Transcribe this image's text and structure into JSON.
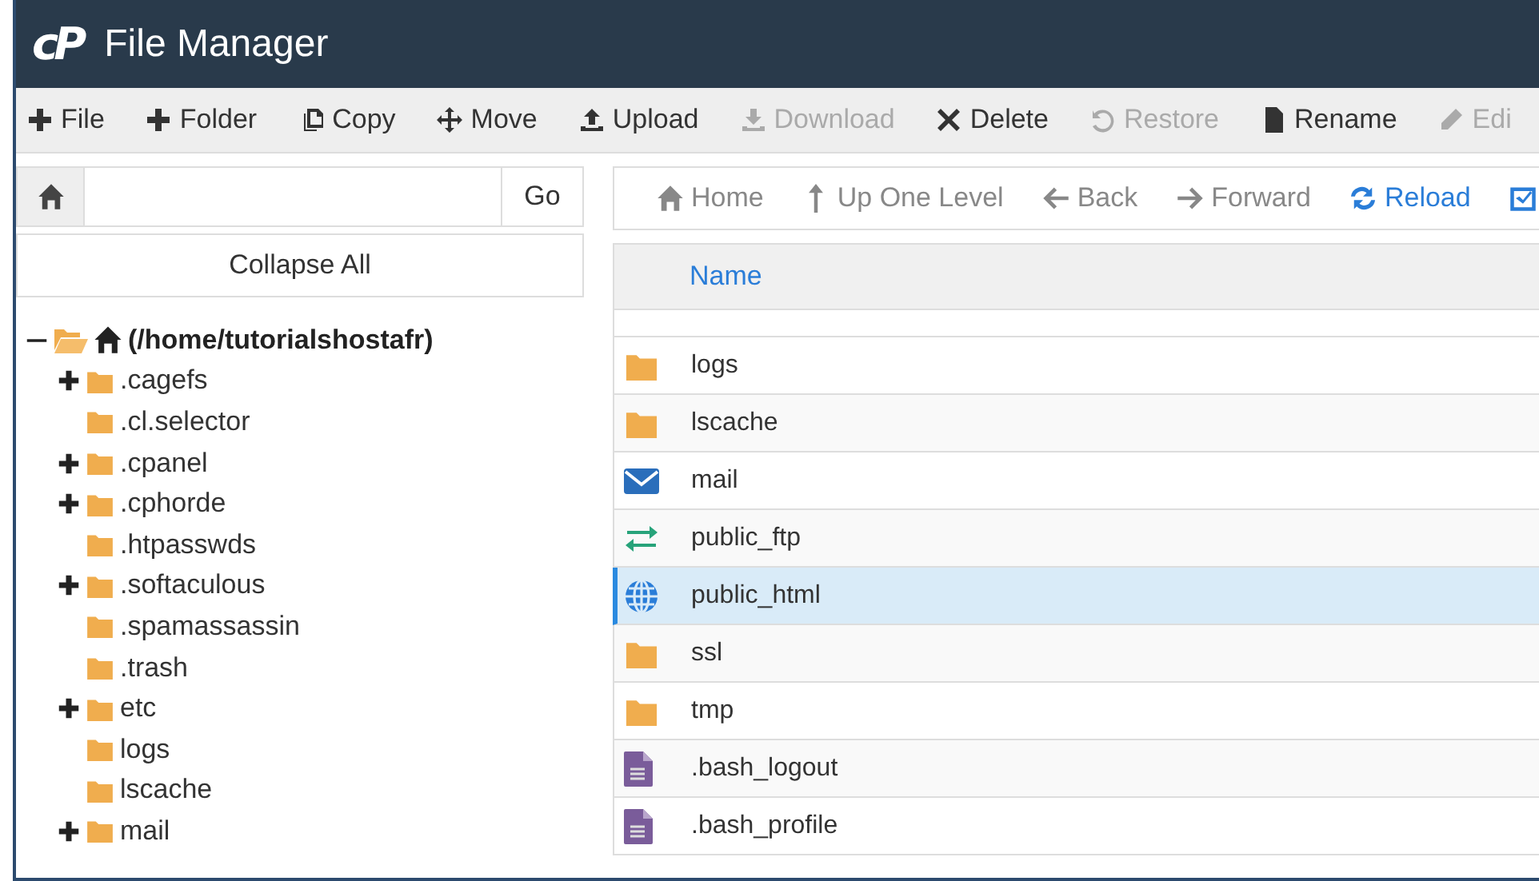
{
  "window": {
    "logo": "cP",
    "title": "File Manager"
  },
  "toolbar": [
    {
      "kind": "plus",
      "label": "File",
      "disabled": false
    },
    {
      "kind": "plus",
      "label": "Folder",
      "disabled": false
    },
    {
      "kind": "copy",
      "label": "Copy",
      "disabled": false
    },
    {
      "kind": "move",
      "label": "Move",
      "disabled": false
    },
    {
      "kind": "upload",
      "label": "Upload",
      "disabled": false
    },
    {
      "kind": "download",
      "label": "Download",
      "disabled": true
    },
    {
      "kind": "x",
      "label": "Delete",
      "disabled": false
    },
    {
      "kind": "restore",
      "label": "Restore",
      "disabled": true
    },
    {
      "kind": "file",
      "label": "Rename",
      "disabled": false
    },
    {
      "kind": "pencil",
      "label": "Edi",
      "disabled": true
    }
  ],
  "path_bar": {
    "button": "Go"
  },
  "collapse_button": "Collapse All",
  "tree": [
    {
      "label": "(/home/tutorialshostafr)",
      "kind": "home",
      "expanded": true,
      "children": [
        {
          "label": ".cagefs",
          "expandable": true
        },
        {
          "label": ".cl.selector",
          "expandable": false
        },
        {
          "label": ".cpanel",
          "expandable": true
        },
        {
          "label": ".cphorde",
          "expandable": true
        },
        {
          "label": ".htpasswds",
          "expandable": false
        },
        {
          "label": ".softaculous",
          "expandable": true
        },
        {
          "label": ".spamassassin",
          "expandable": false
        },
        {
          "label": ".trash",
          "expandable": false
        },
        {
          "label": "etc",
          "expandable": true
        },
        {
          "label": "logs",
          "expandable": false
        },
        {
          "label": "lscache",
          "expandable": false
        },
        {
          "label": "mail",
          "expandable": true
        }
      ]
    }
  ],
  "nav": [
    {
      "kind": "home",
      "label": "Home",
      "disabled": true
    },
    {
      "kind": "up",
      "label": "Up One Level",
      "disabled": true
    },
    {
      "kind": "back",
      "label": "Back",
      "disabled": true
    },
    {
      "kind": "forward",
      "label": "Forward",
      "disabled": true
    },
    {
      "kind": "reload",
      "label": "Reload",
      "disabled": false
    },
    {
      "kind": "checkbox",
      "disabled": false
    }
  ],
  "table": {
    "columns": [
      "Name"
    ],
    "rows": [
      {
        "kind": "folder",
        "name": "logs",
        "selected": false
      },
      {
        "kind": "folder",
        "name": "lscache",
        "selected": false
      },
      {
        "kind": "mail",
        "name": "mail",
        "selected": false
      },
      {
        "kind": "ftp",
        "name": "public_ftp",
        "selected": false
      },
      {
        "kind": "web",
        "name": "public_html",
        "selected": true
      },
      {
        "kind": "folder",
        "name": "ssl",
        "selected": false
      },
      {
        "kind": "folder",
        "name": "tmp",
        "selected": false
      },
      {
        "kind": "file",
        "name": ".bash_logout",
        "selected": false
      },
      {
        "kind": "file",
        "name": ".bash_profile",
        "selected": false
      }
    ]
  }
}
